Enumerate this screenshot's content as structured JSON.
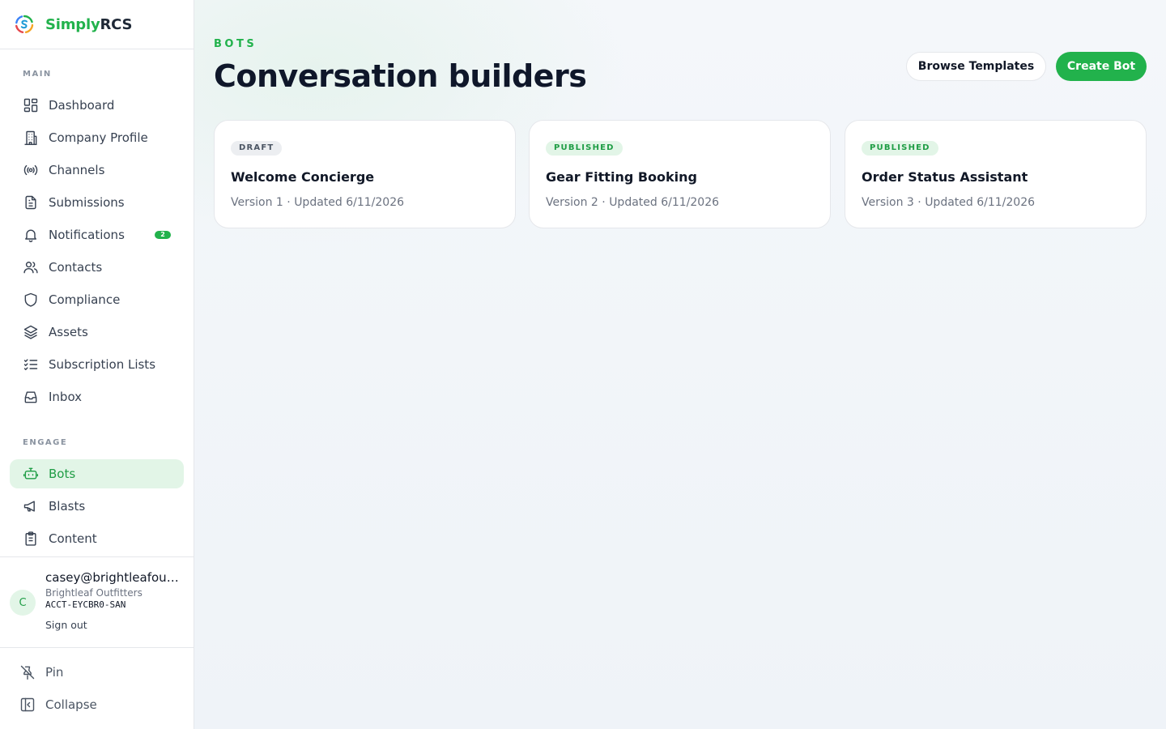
{
  "brand": {
    "name_part1": "Simply",
    "name_part2": "RCS",
    "accent": "#22b24c"
  },
  "sidebar": {
    "sections": [
      {
        "label": "Main"
      },
      {
        "label": "Engage"
      }
    ],
    "items": [
      {
        "label": "Dashboard",
        "icon": "dashboard-icon"
      },
      {
        "label": "Company Profile",
        "icon": "building-icon"
      },
      {
        "label": "Channels",
        "icon": "broadcast-icon"
      },
      {
        "label": "Submissions",
        "icon": "document-icon"
      },
      {
        "label": "Notifications",
        "icon": "bell-icon",
        "badge": "2"
      },
      {
        "label": "Contacts",
        "icon": "users-icon"
      },
      {
        "label": "Compliance",
        "icon": "shield-icon"
      },
      {
        "label": "Assets",
        "icon": "layers-icon"
      },
      {
        "label": "Subscription Lists",
        "icon": "list-check-icon"
      },
      {
        "label": "Inbox",
        "icon": "inbox-icon"
      },
      {
        "label": "Bots",
        "icon": "bot-icon",
        "active": true
      },
      {
        "label": "Blasts",
        "icon": "megaphone-icon"
      },
      {
        "label": "Content",
        "icon": "clipboard-icon"
      }
    ]
  },
  "user": {
    "initial": "C",
    "email": "casey@brightleafoutfitters.com",
    "org": "Brightleaf Outfitters",
    "account": "ACCT-EYCBR0-SAN",
    "signout_label": "Sign out"
  },
  "footer": {
    "pin_label": "Pin",
    "collapse_label": "Collapse"
  },
  "page": {
    "eyebrow": "Bots",
    "title": "Conversation builders",
    "browse_label": "Browse Templates",
    "create_label": "Create Bot"
  },
  "bots": [
    {
      "status": "Draft",
      "name": "Welcome Concierge",
      "meta": "Version 1 · Updated 6/11/2026"
    },
    {
      "status": "Published",
      "name": "Gear Fitting Booking",
      "meta": "Version 2 · Updated 6/11/2026"
    },
    {
      "status": "Published",
      "name": "Order Status Assistant",
      "meta": "Version 3 · Updated 6/11/2026"
    }
  ]
}
